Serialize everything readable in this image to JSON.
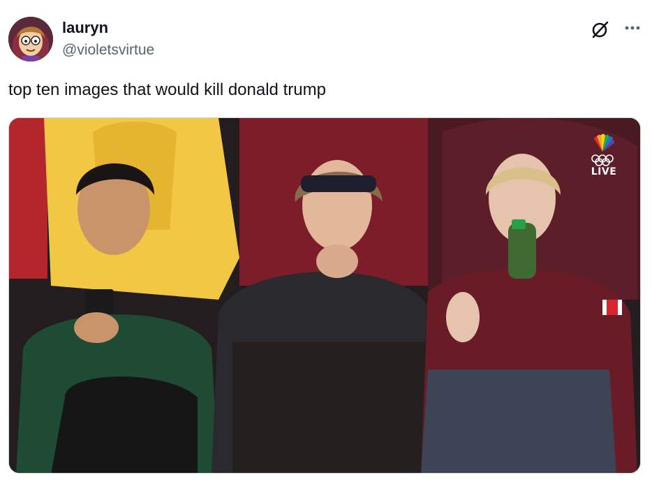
{
  "tweet": {
    "author": {
      "display_name": "lauryn",
      "handle": "@violetsvirtue",
      "avatar_icon": "cartoon-avatar"
    },
    "text": "top ten images that would kill donald trump",
    "actions": {
      "grok_icon": "grok-slash-icon",
      "more_icon": "more-dots-icon"
    },
    "media": {
      "broadcast_logo": "nbc-peacock-olympic-rings",
      "live_label": "LIVE",
      "accent_colors": {
        "peacock_red": "#e12b2b",
        "peacock_orange": "#f6a21a",
        "peacock_yellow": "#f7d21d",
        "peacock_green": "#26a84b",
        "peacock_blue": "#1c78c8",
        "peacock_purple": "#6a3b9a"
      }
    }
  }
}
